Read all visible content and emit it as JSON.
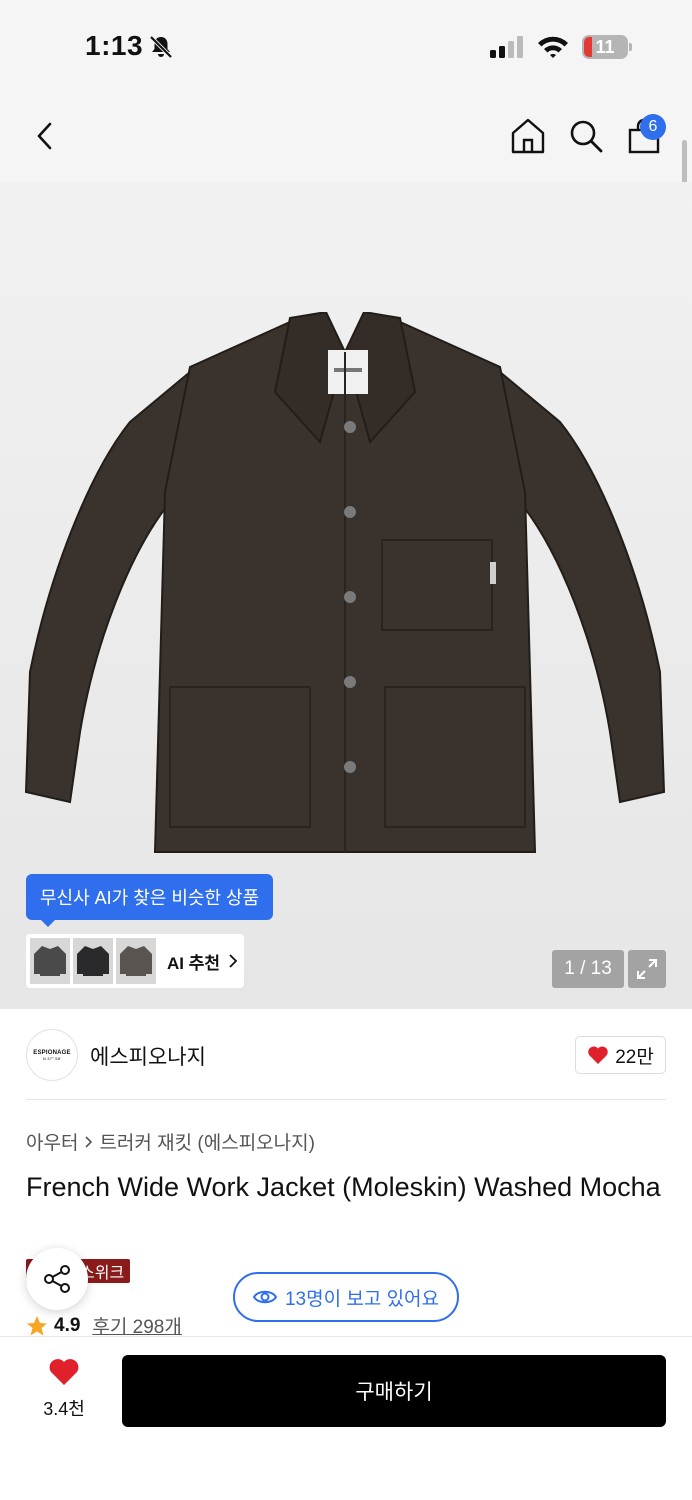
{
  "status_bar": {
    "time": "1:13",
    "battery_level": "11",
    "icons": [
      "bell-slash-icon",
      "signal-icon",
      "wifi-icon",
      "battery-icon"
    ]
  },
  "nav": {
    "icons": [
      "back-icon",
      "home-icon",
      "search-icon",
      "shopping-bag-icon"
    ],
    "cart_count": "6"
  },
  "gallery": {
    "ai_tooltip": "무신사 AI가 찾은 비슷한 상품",
    "ai_recommend_label": "AI 추천",
    "counter": "1 / 13",
    "thumb_colors": [
      "#4a4a4a",
      "#2a2a2d",
      "#5a5450"
    ],
    "jacket_color": "#3a332d"
  },
  "brand": {
    "logo_text": "ESPIONAGE",
    "logo_sub": "N 37° 58'",
    "name": "에스피오나지",
    "like_count": "22만"
  },
  "product": {
    "breadcrumb": [
      "아우터",
      "트러커 재킷 (에스피오나지)"
    ],
    "title": "French Wide Work Jacket (Moleskin) Washed Mocha",
    "sale_badge": "스위크",
    "rating": "4.9",
    "review_link": "후기 298개",
    "viewers": "13명이 보고 있어요"
  },
  "bottom_bar": {
    "wish_count": "3.4천",
    "buy_label": "구매하기"
  },
  "colors": {
    "accent_blue": "#2f6fed",
    "heart_red": "#e0202a",
    "sale_badge": "#8b1b1b",
    "buy_button": "#000000"
  }
}
